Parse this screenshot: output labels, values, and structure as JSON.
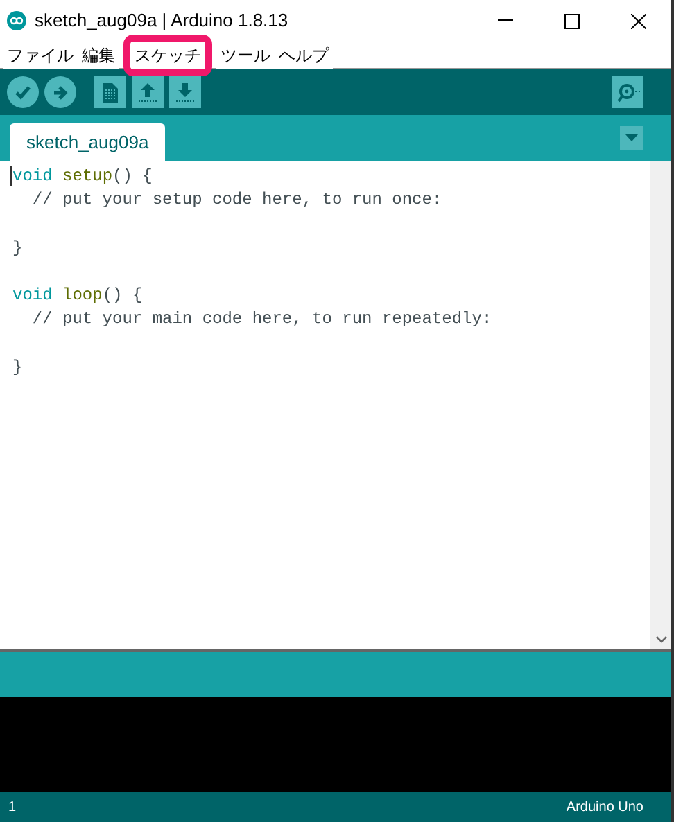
{
  "window": {
    "title": "sketch_aug09a | Arduino 1.8.13"
  },
  "menu": [
    {
      "label": "ファイル",
      "selected": false
    },
    {
      "label": "編集",
      "selected": false
    },
    {
      "label": "スケッチ",
      "selected": true
    },
    {
      "label": "ツール",
      "selected": false
    },
    {
      "label": "ヘルプ",
      "selected": false
    }
  ],
  "tabs": [
    {
      "label": "sketch_aug09a",
      "selected": true
    }
  ],
  "code_blocks": [
    [
      [
        {
          "kind": "keyword",
          "text": "void "
        },
        {
          "kind": "function",
          "text": "setup"
        },
        {
          "kind": "plain",
          "text": "() {"
        }
      ],
      [
        {
          "kind": "comment",
          "text": "  // put your setup code here, to run once:"
        }
      ]
    ],
    [
      [
        {
          "kind": "plain",
          "text": "}"
        }
      ]
    ],
    [
      [
        {
          "kind": "keyword",
          "text": "void "
        },
        {
          "kind": "function",
          "text": "loop"
        },
        {
          "kind": "plain",
          "text": "() {"
        }
      ],
      [
        {
          "kind": "comment",
          "text": "  // put your main code here, to run repeatedly:"
        }
      ]
    ],
    [
      [
        {
          "kind": "plain",
          "text": "}"
        }
      ]
    ]
  ],
  "status_bar": {
    "line": "1",
    "board": "Arduino Uno"
  }
}
